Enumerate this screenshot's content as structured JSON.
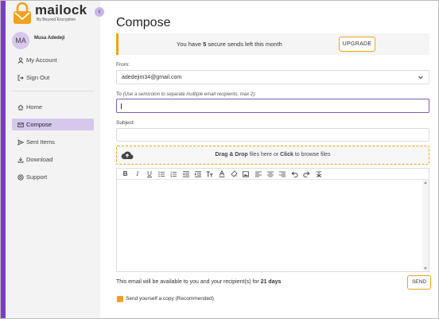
{
  "brand": {
    "name": "mailock",
    "tagline": "By Beyond Encryption"
  },
  "user": {
    "initials": "MA",
    "name": "Musa Adedeji"
  },
  "sidebar": {
    "account_items": [
      {
        "label": "My Account",
        "icon": "user-icon"
      },
      {
        "label": "Sign Out",
        "icon": "sign-out-icon"
      }
    ],
    "nav_items": [
      {
        "label": "Home",
        "icon": "home-icon"
      },
      {
        "label": "Compose",
        "icon": "mail-icon",
        "active": true
      },
      {
        "label": "Sent Items",
        "icon": "send-icon"
      },
      {
        "label": "Download",
        "icon": "download-icon"
      },
      {
        "label": "Support",
        "icon": "help-icon"
      }
    ]
  },
  "page": {
    "title": "Compose"
  },
  "banner": {
    "text_before": "You have ",
    "count": "5",
    "text_after": " secure sends left this month",
    "upgrade_label": "UPGRADE"
  },
  "form": {
    "from_label": "From:",
    "from_value": "adedejim34@gmail.com",
    "to_label": "To",
    "to_hint": "(Use a semicolon to separate multiple email recipients, max 2):",
    "to_value": "",
    "subject_label": "Subject:",
    "subject_value": ""
  },
  "dropzone": {
    "bold1": "Drag & Drop",
    "mid": " files here or ",
    "bold2": "Click",
    "end": " to browse files"
  },
  "toolbar_icons": [
    "bold-icon",
    "italic-icon",
    "underline-icon",
    "bullet-list-icon",
    "numbered-list-icon",
    "outdent-icon",
    "indent-icon",
    "font-size-icon",
    "text-color-icon",
    "background-color-icon",
    "image-icon",
    "align-left-icon",
    "align-center-icon",
    "align-right-icon",
    "undo-icon",
    "redo-icon",
    "clear-format-icon"
  ],
  "footer": {
    "availability_text": "This email will be available to you and your recipient(s) for ",
    "availability_days": "21 days",
    "send_label": "SEND",
    "copy_label": "Send yourself a copy (Recommended)",
    "copy_checked": true
  },
  "colors": {
    "accent": "#7b3fbe",
    "highlight": "#f0a21c",
    "active_nav": "#d6c8ec"
  }
}
